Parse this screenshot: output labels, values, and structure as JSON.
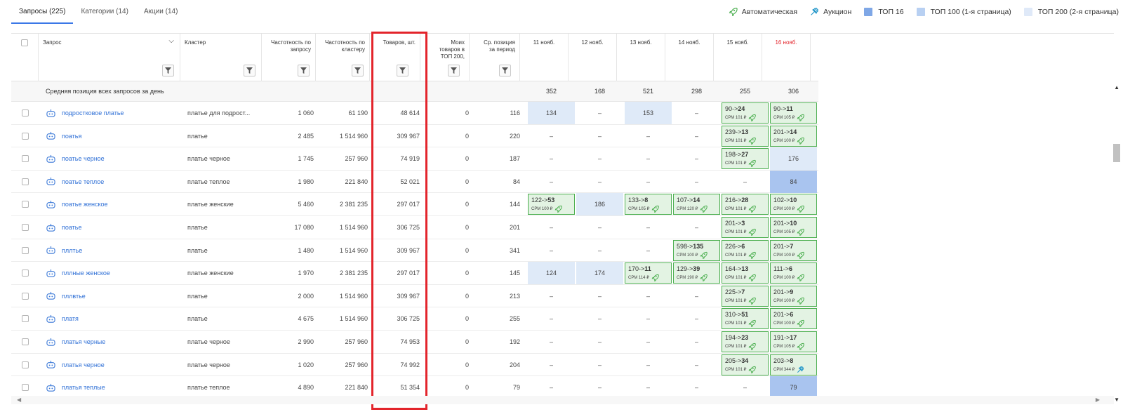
{
  "tabs": [
    {
      "label": "Запросы (225)",
      "active": true
    },
    {
      "label": "Категории (14)",
      "active": false
    },
    {
      "label": "Акции (14)",
      "active": false
    }
  ],
  "legend": {
    "auto": "Автоматическая",
    "auction": "Аукцион",
    "top16": "ТОП 16",
    "top100": "ТОП 100 (1-я страница)",
    "top200": "ТОП 200 (2-я страница)"
  },
  "colors": {
    "top16": "#a9c4ef",
    "top100": "#c6d9f3",
    "top200": "#e2ebf8",
    "auto": "#4caf50",
    "auction": "#2196c9",
    "highlight": "#e3242b",
    "accent": "#3b78e7"
  },
  "header": {
    "query": "Запрос",
    "cluster": "Кластер",
    "freq_query": "Частотность по запросу",
    "freq_cluster": "Частотность по кластеру",
    "goods": "Товаров, шт.",
    "my_goods": "Моих товаров в ТОП 200,",
    "avg_pos": "Ср. позиция за период",
    "dates": [
      "11 нояб.",
      "12 нояб.",
      "13 нояб.",
      "14 нояб.",
      "15 нояб.",
      "16 нояб."
    ]
  },
  "avg_row": {
    "label": "Средняя позиция всех запросов за день",
    "values": [
      "352",
      "168",
      "521",
      "298",
      "255",
      "306"
    ]
  },
  "rows": [
    {
      "query": "подростковое платье",
      "cluster": "платье для подрост...",
      "fq": "1 060",
      "fc": "61 190",
      "goods": "48 614",
      "mine": "0",
      "avg": "116",
      "days": [
        {
          "t": "plain",
          "v": "134",
          "bg": "lb"
        },
        {
          "t": "plain",
          "v": "–"
        },
        {
          "t": "plain",
          "v": "153",
          "bg": "lb"
        },
        {
          "t": "plain",
          "v": "–"
        },
        {
          "t": "ad",
          "from": "90",
          "to": "24",
          "cpm": "СРМ 101 ₽",
          "k": "auto"
        },
        {
          "t": "ad",
          "from": "90",
          "to": "11",
          "cpm": "СРМ 105 ₽",
          "k": "auto"
        }
      ]
    },
    {
      "query": "поатья",
      "cluster": "платье",
      "fq": "2 485",
      "fc": "1 514 960",
      "goods": "309 967",
      "mine": "0",
      "avg": "220",
      "days": [
        {
          "t": "plain",
          "v": "–"
        },
        {
          "t": "plain",
          "v": "–"
        },
        {
          "t": "plain",
          "v": "–"
        },
        {
          "t": "plain",
          "v": "–"
        },
        {
          "t": "ad",
          "from": "239",
          "to": "13",
          "cpm": "СРМ 101 ₽",
          "k": "auto"
        },
        {
          "t": "ad",
          "from": "201",
          "to": "14",
          "cpm": "СРМ 100 ₽",
          "k": "auto"
        }
      ]
    },
    {
      "query": "поатье черное",
      "cluster": "платье черное",
      "fq": "1 745",
      "fc": "257 960",
      "goods": "74 919",
      "mine": "0",
      "avg": "187",
      "days": [
        {
          "t": "plain",
          "v": "–"
        },
        {
          "t": "plain",
          "v": "–"
        },
        {
          "t": "plain",
          "v": "–"
        },
        {
          "t": "plain",
          "v": "–"
        },
        {
          "t": "ad",
          "from": "198",
          "to": "27",
          "cpm": "СРМ 101 ₽",
          "k": "auto"
        },
        {
          "t": "plain",
          "v": "176",
          "bg": "lb"
        }
      ]
    },
    {
      "query": "поатье теплое",
      "cluster": "платье теплое",
      "fq": "1 980",
      "fc": "221 840",
      "goods": "52 021",
      "mine": "0",
      "avg": "84",
      "days": [
        {
          "t": "plain",
          "v": "–"
        },
        {
          "t": "plain",
          "v": "–"
        },
        {
          "t": "plain",
          "v": "–"
        },
        {
          "t": "plain",
          "v": "–"
        },
        {
          "t": "plain",
          "v": "–"
        },
        {
          "t": "plain",
          "v": "84",
          "bg": "mb"
        }
      ]
    },
    {
      "query": "поатье женское",
      "cluster": "платье женские",
      "fq": "5 460",
      "fc": "2 381 235",
      "goods": "297 017",
      "mine": "0",
      "avg": "144",
      "days": [
        {
          "t": "ad",
          "from": "122",
          "to": "53",
          "cpm": "СРМ 100 ₽",
          "k": "auto"
        },
        {
          "t": "plain",
          "v": "186",
          "bg": "lb"
        },
        {
          "t": "ad",
          "from": "133",
          "to": "8",
          "cpm": "СРМ 105 ₽",
          "k": "auto"
        },
        {
          "t": "ad",
          "from": "107",
          "to": "14",
          "cpm": "СРМ 120 ₽",
          "k": "auto"
        },
        {
          "t": "ad",
          "from": "216",
          "to": "28",
          "cpm": "СРМ 101 ₽",
          "k": "auto"
        },
        {
          "t": "ad",
          "from": "102",
          "to": "10",
          "cpm": "СРМ 100 ₽",
          "k": "auto"
        }
      ]
    },
    {
      "query": "поатье",
      "cluster": "платье",
      "fq": "17 080",
      "fc": "1 514 960",
      "goods": "306 725",
      "mine": "0",
      "avg": "201",
      "days": [
        {
          "t": "plain",
          "v": "–"
        },
        {
          "t": "plain",
          "v": "–"
        },
        {
          "t": "plain",
          "v": "–"
        },
        {
          "t": "plain",
          "v": "–"
        },
        {
          "t": "ad",
          "from": "201",
          "to": "3",
          "cpm": "СРМ 101 ₽",
          "k": "auto"
        },
        {
          "t": "ad",
          "from": "201",
          "to": "10",
          "cpm": "СРМ 105 ₽",
          "k": "auto"
        }
      ]
    },
    {
      "query": "пллтье",
      "cluster": "платье",
      "fq": "1 480",
      "fc": "1 514 960",
      "goods": "309 967",
      "mine": "0",
      "avg": "341",
      "days": [
        {
          "t": "plain",
          "v": "–"
        },
        {
          "t": "plain",
          "v": "–"
        },
        {
          "t": "plain",
          "v": "–"
        },
        {
          "t": "ad",
          "from": "598",
          "to": "135",
          "cpm": "СРМ 100 ₽",
          "k": "auto"
        },
        {
          "t": "ad",
          "from": "226",
          "to": "6",
          "cpm": "СРМ 101 ₽",
          "k": "auto"
        },
        {
          "t": "ad",
          "from": "201",
          "to": "7",
          "cpm": "СРМ 100 ₽",
          "k": "auto"
        }
      ]
    },
    {
      "query": "пллные женское",
      "cluster": "платье женские",
      "fq": "1 970",
      "fc": "2 381 235",
      "goods": "297 017",
      "mine": "0",
      "avg": "145",
      "days": [
        {
          "t": "plain",
          "v": "124",
          "bg": "lb"
        },
        {
          "t": "plain",
          "v": "174",
          "bg": "lb"
        },
        {
          "t": "ad",
          "from": "170",
          "to": "11",
          "cpm": "СРМ 114 ₽",
          "k": "auto"
        },
        {
          "t": "ad",
          "from": "129",
          "to": "39",
          "cpm": "СРМ 190 ₽",
          "k": "auto"
        },
        {
          "t": "ad",
          "from": "164",
          "to": "13",
          "cpm": "СРМ 101 ₽",
          "k": "auto"
        },
        {
          "t": "ad",
          "from": "111",
          "to": "6",
          "cpm": "СРМ 100 ₽",
          "k": "auto"
        }
      ]
    },
    {
      "query": "пллвтье",
      "cluster": "платье",
      "fq": "2 000",
      "fc": "1 514 960",
      "goods": "309 967",
      "mine": "0",
      "avg": "213",
      "days": [
        {
          "t": "plain",
          "v": "–"
        },
        {
          "t": "plain",
          "v": "–"
        },
        {
          "t": "plain",
          "v": "–"
        },
        {
          "t": "plain",
          "v": "–"
        },
        {
          "t": "ad",
          "from": "225",
          "to": "7",
          "cpm": "СРМ 101 ₽",
          "k": "auto"
        },
        {
          "t": "ad",
          "from": "201",
          "to": "9",
          "cpm": "СРМ 100 ₽",
          "k": "auto"
        }
      ]
    },
    {
      "query": "платя",
      "cluster": "платье",
      "fq": "4 675",
      "fc": "1 514 960",
      "goods": "306 725",
      "mine": "0",
      "avg": "255",
      "days": [
        {
          "t": "plain",
          "v": "–"
        },
        {
          "t": "plain",
          "v": "–"
        },
        {
          "t": "plain",
          "v": "–"
        },
        {
          "t": "plain",
          "v": "–"
        },
        {
          "t": "ad",
          "from": "310",
          "to": "51",
          "cpm": "СРМ 101 ₽",
          "k": "auto"
        },
        {
          "t": "ad",
          "from": "201",
          "to": "6",
          "cpm": "СРМ 100 ₽",
          "k": "auto"
        }
      ]
    },
    {
      "query": "платья черные",
      "cluster": "платье черное",
      "fq": "2 990",
      "fc": "257 960",
      "goods": "74 953",
      "mine": "0",
      "avg": "192",
      "days": [
        {
          "t": "plain",
          "v": "–"
        },
        {
          "t": "plain",
          "v": "–"
        },
        {
          "t": "plain",
          "v": "–"
        },
        {
          "t": "plain",
          "v": "–"
        },
        {
          "t": "ad",
          "from": "194",
          "to": "23",
          "cpm": "СРМ 101 ₽",
          "k": "auto"
        },
        {
          "t": "ad",
          "from": "191",
          "to": "17",
          "cpm": "СРМ 105 ₽",
          "k": "auto"
        }
      ]
    },
    {
      "query": "платья черное",
      "cluster": "платье черное",
      "fq": "1 020",
      "fc": "257 960",
      "goods": "74 992",
      "mine": "0",
      "avg": "204",
      "days": [
        {
          "t": "plain",
          "v": "–"
        },
        {
          "t": "plain",
          "v": "–"
        },
        {
          "t": "plain",
          "v": "–"
        },
        {
          "t": "plain",
          "v": "–"
        },
        {
          "t": "ad",
          "from": "205",
          "to": "34",
          "cpm": "СРМ 101 ₽",
          "k": "auto"
        },
        {
          "t": "ad",
          "from": "203",
          "to": "8",
          "cpm": "СРМ 344 ₽",
          "k": "auction"
        }
      ]
    },
    {
      "query": "платья теплые",
      "cluster": "платье теплое",
      "fq": "4 890",
      "fc": "221 840",
      "goods": "51 354",
      "mine": "0",
      "avg": "79",
      "days": [
        {
          "t": "plain",
          "v": "–"
        },
        {
          "t": "plain",
          "v": "–"
        },
        {
          "t": "plain",
          "v": "–"
        },
        {
          "t": "plain",
          "v": "–"
        },
        {
          "t": "plain",
          "v": "–"
        },
        {
          "t": "plain",
          "v": "79",
          "bg": "mb"
        }
      ]
    }
  ]
}
